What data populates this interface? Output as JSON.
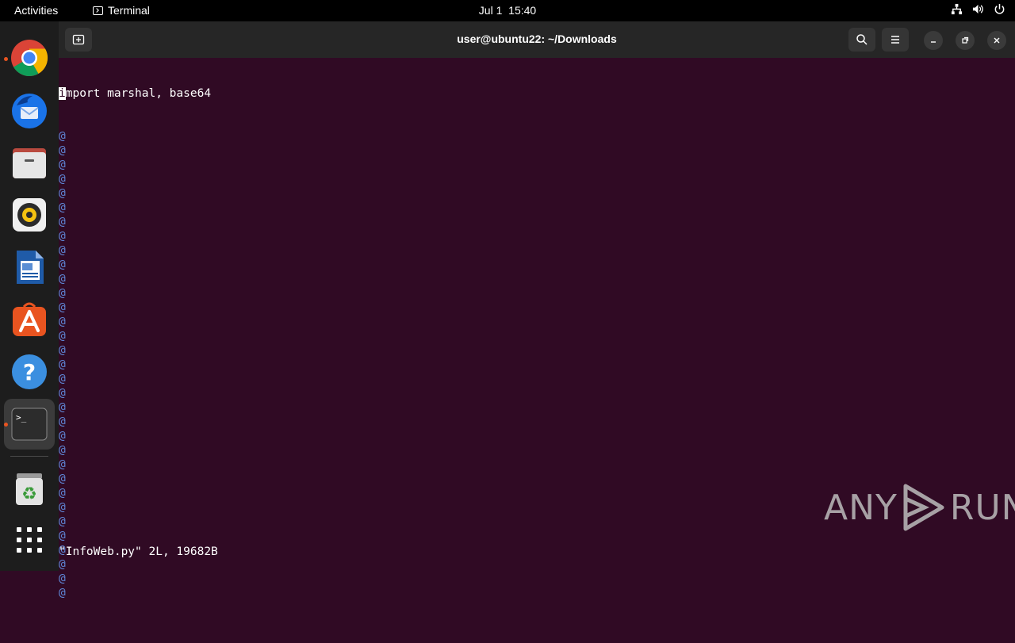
{
  "topbar": {
    "activities": "Activities",
    "app_name": "Terminal",
    "date": "Jul 1",
    "time": "15:40"
  },
  "dock": {
    "apps": [
      "Google Chrome",
      "Thunderbird Mail",
      "Files",
      "Rhythmbox",
      "LibreOffice Writer",
      "Ubuntu Software",
      "Help",
      "Terminal",
      "Trash",
      "Show Applications"
    ]
  },
  "window": {
    "title": "user@ubuntu22: ~/Downloads"
  },
  "editor": {
    "cursor_char": "i",
    "first_line_rest": "mport marshal, base64",
    "filler": "@",
    "filler_rows": 33,
    "status": "\"InfoWeb.py\" 2L, 19682B"
  },
  "watermark": {
    "left": "ANY",
    "right": "RUN"
  },
  "colors": {
    "terminal_bg": "#300a24",
    "accent_orange": "#e95420",
    "tilde_blue": "#5f87d7"
  }
}
